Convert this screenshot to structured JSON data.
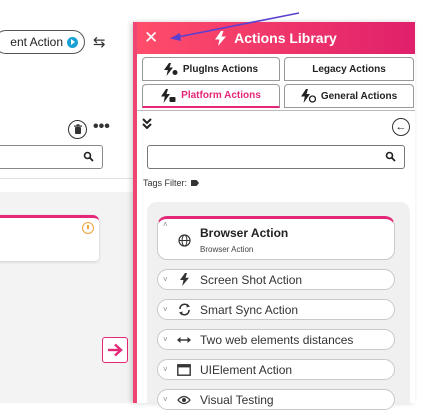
{
  "editor": {
    "action_pill_label": "ent Action",
    "swap_icon": "⇆",
    "more_icon": "•••"
  },
  "panel": {
    "close_label": "✕",
    "title": "Actions Library",
    "tabs": [
      {
        "label": "PlugIns Actions"
      },
      {
        "label": "Legacy Actions"
      },
      {
        "label": "Platform Actions"
      },
      {
        "label": "General Actions"
      }
    ],
    "collapse_icon": "»",
    "back_icon": "←",
    "search": {
      "value": "",
      "placeholder": ""
    },
    "tags_filter_label": "Tags Filter:",
    "expanded_item": {
      "title": "Browser Action",
      "subtitle": "Browser Action"
    },
    "items": [
      {
        "label": "Screen Shot Action",
        "icon": "bolt-icon"
      },
      {
        "label": "Smart Sync Action",
        "icon": "sync-icon"
      },
      {
        "label": "Two web elements distances",
        "icon": "arrows-horizontal-icon"
      },
      {
        "label": "UIElement Action",
        "icon": "window-icon"
      },
      {
        "label": "Visual Testing",
        "icon": "eye-icon"
      }
    ]
  },
  "colors": {
    "accent": "#e52777",
    "header_start": "#ff4d6a",
    "header_end": "#e0206b",
    "clock": "#f2a33a",
    "play": "#1aa1d6"
  }
}
